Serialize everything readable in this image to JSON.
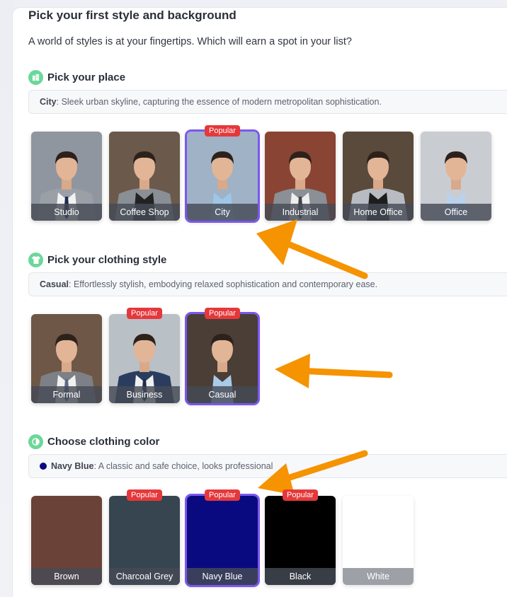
{
  "heading": "Pick your first style and background",
  "subheading": "A world of styles is at your fingertips. Which will earn a spot in your list?",
  "place": {
    "title": "Pick your place",
    "desc_name": "City",
    "desc_text": ": Sleek urban skyline, capturing the essence of modern metropolitan sophistication.",
    "options": [
      {
        "label": "Studio",
        "popular": false,
        "selected": false,
        "bg": "#8f969f"
      },
      {
        "label": "Coffee Shop",
        "popular": false,
        "selected": false,
        "bg": "#6b5a4c"
      },
      {
        "label": "City",
        "popular": true,
        "selected": true,
        "bg": "#9fb2c6"
      },
      {
        "label": "Industrial",
        "popular": false,
        "selected": false,
        "bg": "#8a4434"
      },
      {
        "label": "Home Office",
        "popular": false,
        "selected": false,
        "bg": "#5a4a3c"
      },
      {
        "label": "Office",
        "popular": false,
        "selected": false,
        "bg": "#c9cdd2"
      }
    ]
  },
  "clothing": {
    "title": "Pick your clothing style",
    "desc_name": "Casual",
    "desc_text": ": Effortlessly stylish, embodying relaxed sophistication and contemporary ease.",
    "options": [
      {
        "label": "Formal",
        "popular": false,
        "selected": false,
        "bg": "#6e5746"
      },
      {
        "label": "Business",
        "popular": true,
        "selected": false,
        "bg": "#b9c0c6"
      },
      {
        "label": "Casual",
        "popular": true,
        "selected": true,
        "bg": "#4a3e36"
      }
    ]
  },
  "color": {
    "title": "Choose clothing color",
    "desc_name": "Navy Blue",
    "desc_text": ": A classic and safe choice, looks professional",
    "desc_dot": "#0a0a80",
    "options": [
      {
        "label": "Brown",
        "popular": false,
        "selected": false,
        "color": "#6b4238"
      },
      {
        "label": "Charcoal Grey",
        "popular": true,
        "selected": false,
        "color": "#36454f"
      },
      {
        "label": "Navy Blue",
        "popular": true,
        "selected": true,
        "color": "#0a0a80"
      },
      {
        "label": "Black",
        "popular": true,
        "selected": false,
        "color": "#000000"
      },
      {
        "label": "White",
        "popular": false,
        "selected": false,
        "color": "#ffffff"
      }
    ]
  },
  "badge_text": "Popular",
  "icons": {
    "place": "building-icon",
    "clothing": "shirt-icon",
    "color": "contrast-icon"
  },
  "colors": {
    "accent": "#7b57f0",
    "badge": "#e5383b",
    "arrow": "#f59300",
    "section_icon": "#6cd79a"
  }
}
